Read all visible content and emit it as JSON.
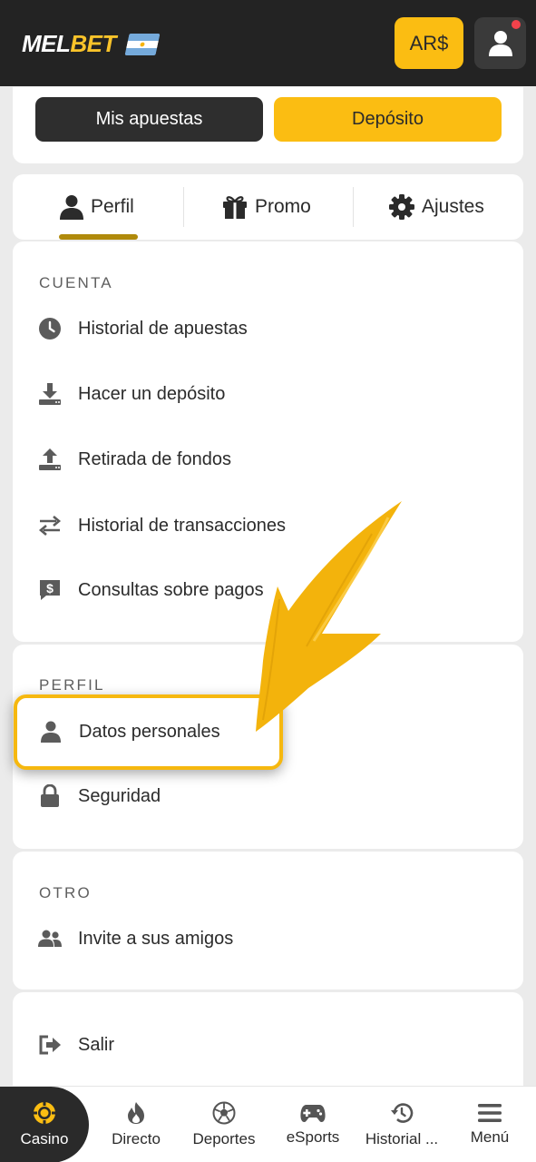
{
  "header": {
    "logo_main": "MEL",
    "logo_accent": "BET",
    "currency": "AR$",
    "notification": true
  },
  "actions": {
    "bets_label": "Mis apuestas",
    "deposit_label": "Depósito"
  },
  "tabs": [
    {
      "label": "Perfil",
      "icon": "user-icon",
      "active": true
    },
    {
      "label": "Promo",
      "icon": "gift-icon"
    },
    {
      "label": "Ajustes",
      "icon": "gear-icon"
    }
  ],
  "cuenta": {
    "title": "CUENTA",
    "items": [
      {
        "label": "Historial de apuestas",
        "icon": "clock-icon"
      },
      {
        "label": "Hacer un depósito",
        "icon": "download-icon"
      },
      {
        "label": "Retirada de fondos",
        "icon": "upload-icon"
      },
      {
        "label": "Historial de transacciones",
        "icon": "transfer-arrows-icon"
      },
      {
        "label": "Consultas sobre pagos",
        "icon": "dollar-chat-icon"
      }
    ]
  },
  "perfil": {
    "title": "PERFIL",
    "items": [
      {
        "label": "Datos personales",
        "icon": "person-icon",
        "highlighted": true
      },
      {
        "label": "Seguridad",
        "icon": "lock-icon"
      }
    ]
  },
  "otro": {
    "title": "OTRO",
    "items": [
      {
        "label": "Invite a sus amigos",
        "icon": "people-icon"
      }
    ]
  },
  "salir": {
    "label": "Salir",
    "icon": "logout-icon"
  },
  "bottom_nav": [
    {
      "label": "Casino",
      "icon": "casino-chip-icon",
      "active": true
    },
    {
      "label": "Directo",
      "icon": "flame-icon"
    },
    {
      "label": "Deportes",
      "icon": "soccer-ball-icon"
    },
    {
      "label": "eSports",
      "icon": "gamepad-icon"
    },
    {
      "label": "Historial ...",
      "icon": "history-icon"
    },
    {
      "label": "Menú",
      "icon": "hamburger-icon"
    }
  ],
  "colors": {
    "accent": "#fbbd12",
    "dark": "#232323",
    "highlight": "#f6b80f"
  }
}
